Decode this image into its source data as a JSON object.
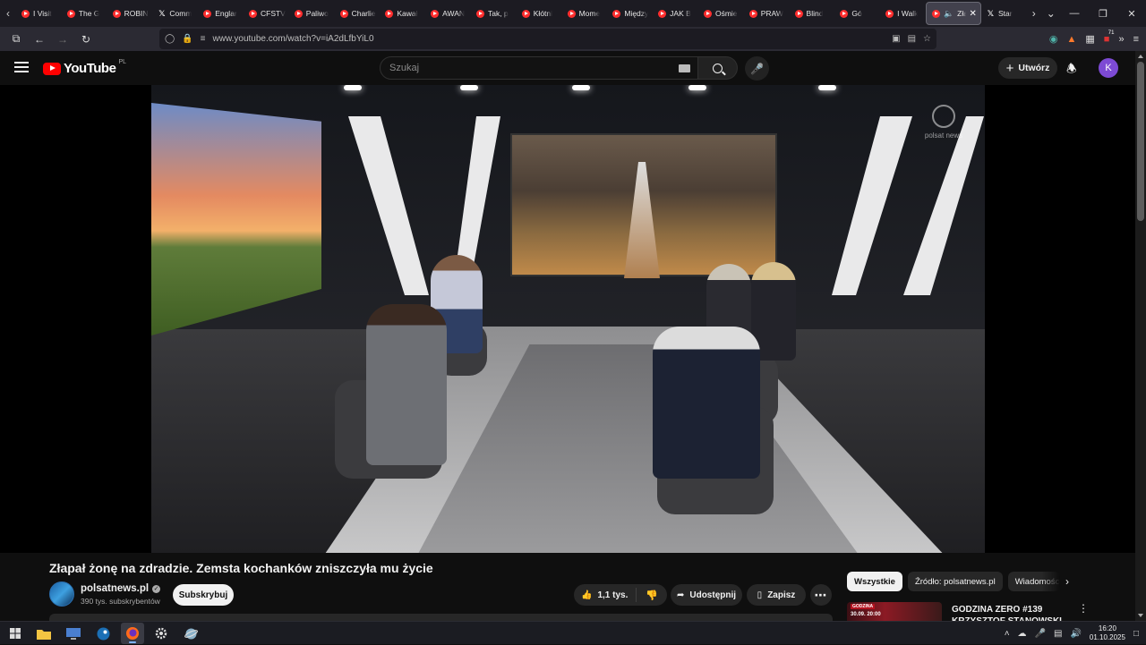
{
  "browser": {
    "tabs": [
      {
        "label": "I Visit",
        "icon": "youtube-icon"
      },
      {
        "label": "The G",
        "icon": "youtube-icon"
      },
      {
        "label": "ROBIN",
        "icon": "youtube-icon"
      },
      {
        "label": "Comm",
        "icon": "x-icon"
      },
      {
        "label": "Englar",
        "icon": "youtube-icon"
      },
      {
        "label": "CFSTV",
        "icon": "youtube-icon"
      },
      {
        "label": "Paliwo",
        "icon": "youtube-icon"
      },
      {
        "label": "Charlie",
        "icon": "youtube-icon"
      },
      {
        "label": "Kawał",
        "icon": "youtube-icon"
      },
      {
        "label": "AWAN",
        "icon": "youtube-icon"
      },
      {
        "label": "Tak, p",
        "icon": "youtube-icon"
      },
      {
        "label": "Kłótni",
        "icon": "youtube-icon"
      },
      {
        "label": "Mome",
        "icon": "youtube-icon"
      },
      {
        "label": "Między",
        "icon": "youtube-icon"
      },
      {
        "label": "JAK B",
        "icon": "youtube-icon"
      },
      {
        "label": "Ośmie",
        "icon": "youtube-icon"
      },
      {
        "label": "PRAW",
        "icon": "youtube-icon"
      },
      {
        "label": "Blind",
        "icon": "youtube-icon"
      },
      {
        "label": "Gó",
        "icon": "youtube-icon"
      },
      {
        "label": "I Walk",
        "icon": "youtube-icon"
      }
    ],
    "active_tab": {
      "label": "Złap",
      "icon": "youtube-icon",
      "audio": "speaker-icon"
    },
    "trailing_tab": {
      "label": "Star",
      "icon": "x-icon"
    },
    "url": "www.youtube.com/watch?v=iA2dLfbYiL0",
    "extension_badge": "71"
  },
  "youtube": {
    "logo_text": "YouTube",
    "country_code": "PL",
    "search_placeholder": "Szukaj",
    "create_label": "Utwórz",
    "avatar_letter": "K"
  },
  "player": {
    "channel_bug": "polsat news"
  },
  "video": {
    "title": "Złapał żonę na zdradzie. Zemsta kochanków zniszczyła mu życie",
    "channel_name": "polsatnews.pl",
    "verified": "✓",
    "subscribers": "390 tys. subskrybentów",
    "subscribe_label": "Subskrybuj",
    "likes": "1,1 tys.",
    "share_label": "Udostępnij",
    "save_label": "Zapisz"
  },
  "sidebar": {
    "chips": [
      "Wszystkie",
      "Źródło: polsatnews.pl",
      "Wiadomości"
    ],
    "active_chip": 0,
    "recommendation": {
      "thumb_badge": "GODZINA",
      "thumb_time": "30.09. 20:00",
      "title": "GODZINA ZERO #139 KRZYSZTOF STANOWSKI"
    }
  },
  "taskbar": {
    "time": "16:20",
    "date": "01.10.2025"
  }
}
